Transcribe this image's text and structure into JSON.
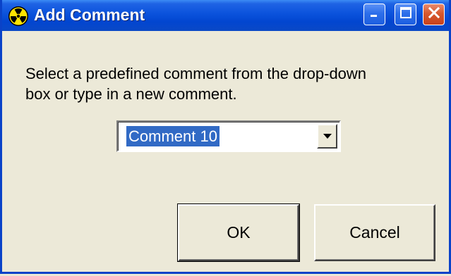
{
  "window": {
    "title": "Add Comment",
    "icon": "radiation-icon"
  },
  "titlebar_buttons": {
    "minimize": "minimize-icon",
    "maximize": "maximize-icon",
    "close": "close-icon"
  },
  "message": {
    "line1": "Select a predefined comment from the drop-down",
    "line2": "box or type in a new comment."
  },
  "combo": {
    "value": "Comment 10"
  },
  "buttons": {
    "ok": "OK",
    "cancel": "Cancel"
  },
  "colors": {
    "titlebar": "#0A52DC",
    "face": "#ECE9D8",
    "selection": "#316AC5",
    "close": "#D8582E"
  }
}
